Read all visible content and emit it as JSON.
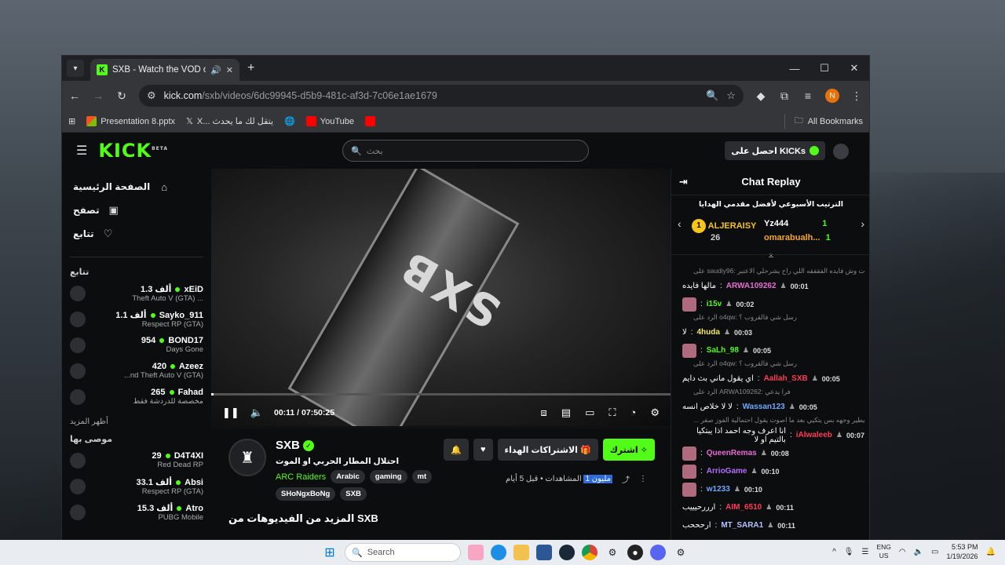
{
  "browser": {
    "tab_title": "SXB - Watch the VOD on Kick",
    "url_host": "kick.com",
    "url_path": "/sxb/videos/6dc99945-d5b9-481c-af3d-7c06e1ae1679",
    "bookmarks": [
      "Presentation 8.pptx",
      "X... يتقل لك ما يحدث",
      "YouTube"
    ],
    "all_bookmarks": "All Bookmarks",
    "profile_initial": "N"
  },
  "header": {
    "logo": "KICK",
    "logo_beta": "BETA",
    "search_placeholder": "بحث",
    "get_kicks": "احصل على KICKs"
  },
  "sidebar": {
    "nav": [
      {
        "label": "الصفحة الرئيسية",
        "icon": "home-icon"
      },
      {
        "label": "تصفح",
        "icon": "browse-icon"
      },
      {
        "label": "تتابع",
        "icon": "heart-icon"
      }
    ],
    "following_title": "تتابع",
    "following": [
      {
        "name": "xEiD",
        "count": "1.3 ألف",
        "game": "Theft Auto V (GTA) ..."
      },
      {
        "name": "Sayko_911",
        "count": "1.1 ألف",
        "game": "Respect RP (GTA)"
      },
      {
        "name": "BOND17",
        "count": "954",
        "game": "Days Gone"
      },
      {
        "name": "Azeez",
        "count": "420",
        "game": "...nd Theft Auto V (GTA)"
      },
      {
        "name": "Fahad",
        "count": "265",
        "game": "مخصصة للدردشة فقط"
      }
    ],
    "show_more": "أظهر المزيد",
    "recommended_title": "موصى بها",
    "recommended": [
      {
        "name": "D4T4XI",
        "count": "29",
        "game": "Red Dead RP"
      },
      {
        "name": "Absi",
        "count": "33.1 ألف",
        "game": "Respect RP (GTA)"
      },
      {
        "name": "Atro",
        "count": "15.3 ألف",
        "game": "PUBG Mobile"
      }
    ]
  },
  "player": {
    "banner_text": "SXB",
    "time": "00:11 / 07:50:25",
    "progress_fraction": 0.0004
  },
  "video": {
    "channel": "SXB",
    "title": "احتلال المطار الحربي او الموت",
    "category": "ARC Raiders",
    "tags": [
      "Arabic",
      "gaming",
      "mt"
    ],
    "tags2": [
      "SHoNgxBoNg",
      "SXB"
    ],
    "subscribe": "اشترك",
    "gift": "الاشتراكات الهداء",
    "posted": "قبل 5 أيام",
    "views_label": "المشاهدات",
    "views": "مليون 1",
    "more_videos": "المزيد من الفيديوهات من SXB"
  },
  "chat": {
    "title": "Chat Replay",
    "leaderboard_title": "الترتيب الأسبوعي لأفضل مقدمي الهدايا",
    "lb": [
      {
        "rank": "1",
        "name": "ALJERAISY",
        "count": "26"
      },
      {
        "name": "Yz444",
        "count": "1"
      },
      {
        "name": "omarabualh...",
        "count": "1"
      }
    ],
    "messages": [
      {
        "reply": "على saudiy96: شات وش فايده الفقفقه اللي راح يشرحلي الاعتبر ...",
        "time": "00:01",
        "user": "ARWA109262",
        "color": "#e66cd6",
        "text": "مالها فايده"
      },
      {
        "time": "00:02",
        "user": "i15v",
        "color": "#53fc18",
        "text": ""
      },
      {
        "reply": "الرد على o4qw: رسل شي فالقروب ؟",
        "time": "00:03",
        "user": "4huda",
        "color": "#f3e76a",
        "text": "لا"
      },
      {
        "time": "00:05",
        "user": "SaLh_98",
        "color": "#53fc18",
        "text": ""
      },
      {
        "reply": "الرد على o4qw: رسل شي فالقروب ؟",
        "time": "00:05",
        "user": "Aallah_SXB",
        "color": "#ff3b57",
        "text": "اي يقول ماني بث دايم"
      },
      {
        "reply": "الرد على ARWA109262: فرا يدعي",
        "time": "00:05",
        "user": "Wassan123",
        "color": "#6ea8ff",
        "text": "لا لا خلاص انسه"
      },
      {
        "reply": "... مايطير وجهه بس يتكيي بعد ما اصوت يقول احتمالية الفوز صفر",
        "time": "00:07",
        "user": "iAlwaleeb",
        "color": "#ff3b57",
        "text": "انا اعرف وجه احمد اذا يبتكيا بالتيم او لا"
      },
      {
        "time": "00:08",
        "user": "QueenRemas",
        "color": "#e66cd6",
        "text": ""
      },
      {
        "time": "00:10",
        "user": "ArrioGame",
        "color": "#b66bff",
        "text": ""
      },
      {
        "time": "00:10",
        "user": "w1233",
        "color": "#6ea8ff",
        "text": ""
      },
      {
        "time": "00:11",
        "user": "AIM_6510",
        "color": "#ff3b57",
        "text": "ارررحيييب"
      },
      {
        "time": "00:11",
        "user": "MT_SARA1",
        "color": "#b8c0ff",
        "text": "ارحححب"
      }
    ]
  },
  "taskbar": {
    "search": "Search",
    "lang": "ENG",
    "region": "US",
    "time": "5:53 PM",
    "date": "1/19/2026"
  }
}
